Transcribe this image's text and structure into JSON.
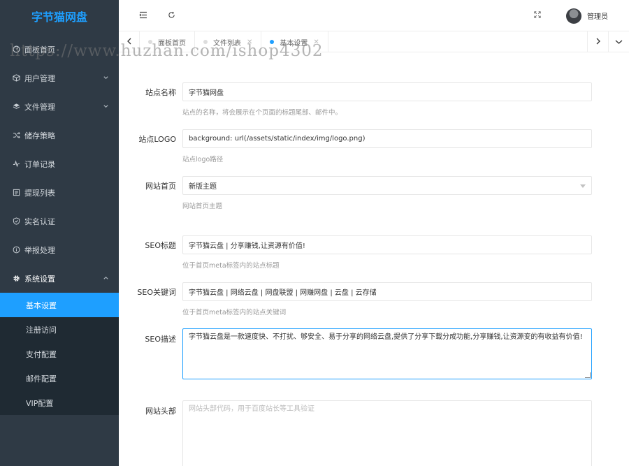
{
  "app": {
    "logo": "字节猫网盘"
  },
  "sidebar": {
    "items": [
      {
        "label": "面板首页",
        "icon": "dashboard-icon"
      },
      {
        "label": "用户管理",
        "icon": "cube-icon",
        "chevron": "down"
      },
      {
        "label": "文件管理",
        "icon": "layers-icon",
        "chevron": "down"
      },
      {
        "label": "储存策略",
        "icon": "shuffle-icon"
      },
      {
        "label": "订单记录",
        "icon": "pulse-icon"
      },
      {
        "label": "提现列表",
        "icon": "list-icon"
      },
      {
        "label": "实名认证",
        "icon": "shield-icon"
      },
      {
        "label": "举报处理",
        "icon": "info-icon"
      },
      {
        "label": "系统设置",
        "icon": "gear-icon",
        "chevron": "up"
      }
    ],
    "submenu": [
      {
        "label": "基本设置",
        "active": true
      },
      {
        "label": "注册访问"
      },
      {
        "label": "支付配置"
      },
      {
        "label": "邮件配置"
      },
      {
        "label": "VIP配置"
      }
    ]
  },
  "header": {
    "user_name": "管理员"
  },
  "tabs": [
    {
      "label": "面板首页"
    },
    {
      "label": "文件列表"
    },
    {
      "label": "基本设置",
      "active": true
    }
  ],
  "form": {
    "site_name": {
      "label": "站点名称",
      "value": "字节猫网盘",
      "help": "站点的名称，将会展示在个页面的标题尾部、邮件中。"
    },
    "site_logo": {
      "label": "站点LOGO",
      "value": "background: url(/assets/static/index/img/logo.png)",
      "help": "站点logo路径"
    },
    "home": {
      "label": "网站首页",
      "value": "新版主题",
      "help": "网站首页主题"
    },
    "seo_title": {
      "label": "SEO标题",
      "value": "字节猫云盘 | 分享赚钱,让资源有价值!",
      "help": "位于首页meta标签内的站点标题"
    },
    "seo_keywords": {
      "label": "SEO关键词",
      "value": "字节猫云盘 | 网络云盘 | 网盘联盟 | 网赚网盘 | 云盘 | 云存储",
      "help": "位于首页meta标签内的站点关键词"
    },
    "seo_desc": {
      "label": "SEO描述",
      "value": "字节猫云盘是一款速度快、不打扰、够安全、易于分享的网络云盘,提供了分享下载分成功能,分享赚钱,让资源变的有收益有价值!"
    },
    "site_head": {
      "label": "网站头部",
      "placeholder": "网站头部代码，用于百度站长等工具验证"
    }
  },
  "watermark": "https://www.huzhan.com/ishop4302",
  "colors": {
    "accent": "#1e9fff",
    "sidebar_bg": "#2f3a45",
    "submenu_bg": "#1f2a33"
  }
}
